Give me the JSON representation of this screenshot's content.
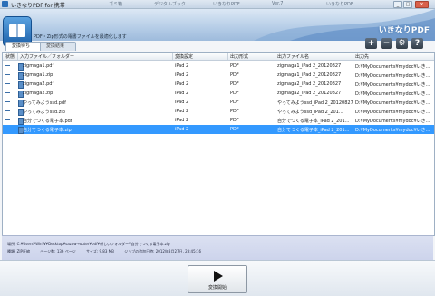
{
  "window": {
    "title": "いきなりPDF for 携帯",
    "background_tabs": [
      "ゴミ箱",
      "デジタルブック",
      "いきなりPDF",
      "Ver.7",
      "いきなりPDF"
    ],
    "buttons": {
      "minimize": "_",
      "maximize": "□",
      "close": "×"
    }
  },
  "header": {
    "brand": "いきなりPDF",
    "subtitle": "PDF・Zip形式の電書ファイルを最適化します"
  },
  "tabs": [
    {
      "label": "変換待ち",
      "active": true
    },
    {
      "label": "変換結果",
      "active": false
    }
  ],
  "toolbar": {
    "add_icon": "plus-icon",
    "add_label": "+",
    "remove_icon": "minus-icon",
    "remove_label": "−",
    "settings_icon": "gear-icon",
    "settings_label": "⚙",
    "help_icon": "question-icon",
    "help_label": "?"
  },
  "table": {
    "columns": [
      "状態",
      "入力ファイル／フォルダー",
      "変換設定",
      "出力形式",
      "出力ファイル名",
      "出力先"
    ],
    "rows": [
      {
        "status": "—",
        "input": "zigmaga1.pdf",
        "setting": "iPad 2",
        "format": "PDF",
        "outname": "zigmaga1_iPad 2_20120827",
        "dest": "D:¥MyDocuments¥mydoc¥いき..."
      },
      {
        "status": "—",
        "input": "zigmaga1.zip",
        "setting": "iPad 2",
        "format": "PDF",
        "outname": "zigmaga1_iPad 2_20120827",
        "dest": "D:¥MyDocuments¥mydoc¥いき..."
      },
      {
        "status": "—",
        "input": "zigmaga2.pdf",
        "setting": "iPad 2",
        "format": "PDF",
        "outname": "zigmaga2_iPad 2_20120827",
        "dest": "D:¥MyDocuments¥mydoc¥いき..."
      },
      {
        "status": "—",
        "input": "zigmaga2.zip",
        "setting": "iPad 2",
        "format": "PDF",
        "outname": "zigmaga2_iPad 2_20120827",
        "dest": "D:¥MyDocuments¥mydoc¥いき..."
      },
      {
        "status": "—",
        "input": "やってみようssd.pdf",
        "setting": "iPad 2",
        "format": "PDF",
        "outname": "やってみようssd_iPad 2_20120827",
        "dest": "D:¥MyDocuments¥mydoc¥いき..."
      },
      {
        "status": "—",
        "input": "やってみようssd.zip",
        "setting": "iPad 2",
        "format": "PDF",
        "outname": "やってみようssd_iPad 2_201...",
        "dest": "D:¥MyDocuments¥mydoc¥いき..."
      },
      {
        "status": "—",
        "input": "自分でつくる電子本.pdf",
        "setting": "iPad 2",
        "format": "PDF",
        "outname": "自分でつくる電子本_iPad 2_201...",
        "dest": "D:¥MyDocuments¥mydoc¥いき..."
      },
      {
        "status": "—",
        "input": "自分でつくる電子本.zip",
        "setting": "iPad 2",
        "format": "PDF",
        "outname": "自分でつくる電子本_iPad 2_201...",
        "dest": "D:¥MyDocuments¥mydoc¥いき...",
        "selected": true
      }
    ]
  },
  "info": {
    "location_label": "場所:",
    "location_value": "C:¥Users¥WinW¥Desktop¥sazow→outer¥pdf¥新しいフォルダー¥自分でつくる電子本.zip",
    "type_label": "種類:",
    "type_value": "ZIP圧縮",
    "pages_label": "ページ数:",
    "pages_value": "136 ページ",
    "size_label": "サイズ:",
    "size_value": "9.83 MB",
    "date_label": "ジョブの追加日時:",
    "date_value": "2012年8月27日, 23:45:16"
  },
  "bottom": {
    "start_label": "変換開始",
    "start_icon": "play-icon"
  }
}
